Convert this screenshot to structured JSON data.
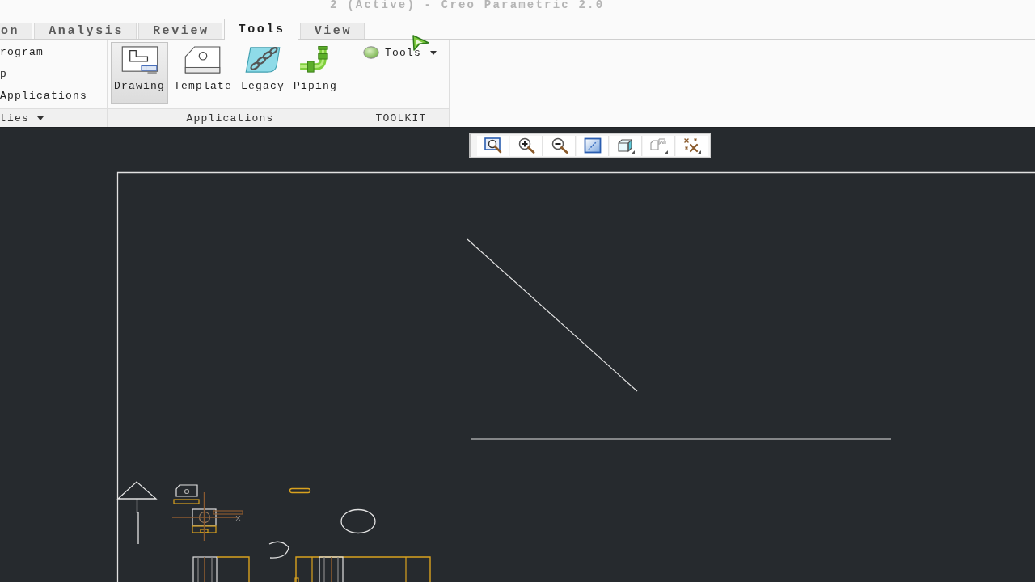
{
  "title": "2 (Active) - Creo Parametric 2.0",
  "tabs": [
    {
      "label": "on",
      "selected": false
    },
    {
      "label": "Analysis",
      "selected": false
    },
    {
      "label": "Review",
      "selected": false
    },
    {
      "label": "Tools",
      "selected": true
    },
    {
      "label": "View",
      "selected": false
    }
  ],
  "ribbon": {
    "groups": [
      {
        "kind": "list",
        "items": [
          "rogram",
          "p",
          "Applications"
        ],
        "label": "ties",
        "has_menu": true
      },
      {
        "kind": "buttons",
        "buttons": [
          {
            "kind": "drawing",
            "label": "Drawing",
            "selected": true
          },
          {
            "kind": "template",
            "label": "Template",
            "selected": false
          },
          {
            "kind": "legacy",
            "label": "Legacy",
            "selected": false
          },
          {
            "kind": "piping",
            "label": "Piping",
            "selected": false
          }
        ],
        "label": "Applications",
        "has_menu": false
      },
      {
        "kind": "dropdown",
        "dropdown": "Tools",
        "label": "TOOLKIT",
        "has_menu": false
      }
    ]
  },
  "graphics_toolbar": {
    "buttons": [
      {
        "kind": "refit"
      },
      {
        "kind": "zoom-in"
      },
      {
        "kind": "zoom-out"
      },
      {
        "kind": "repaint"
      },
      {
        "kind": "display-style"
      },
      {
        "kind": "saved-views"
      },
      {
        "kind": "datum-display"
      }
    ]
  }
}
